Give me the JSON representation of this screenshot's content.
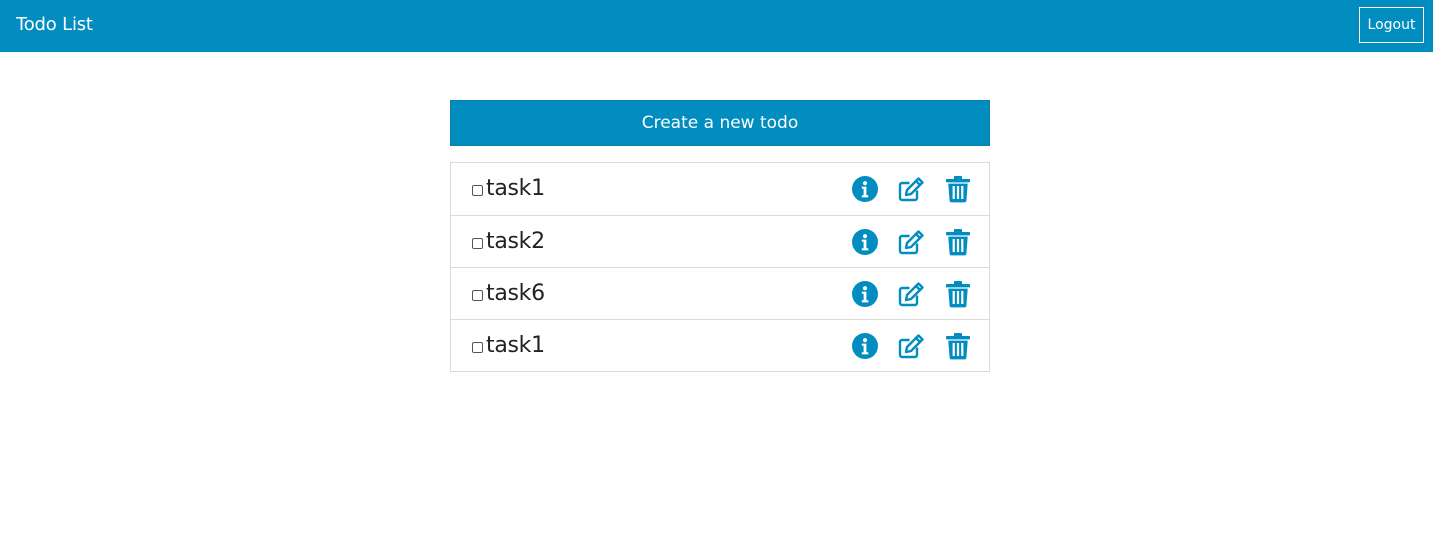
{
  "navbar": {
    "title": "Todo List",
    "logout_label": "Logout",
    "color": "#018dbf"
  },
  "main": {
    "create_label": "Create a new todo",
    "todos": [
      {
        "label": "task1",
        "checked": false
      },
      {
        "label": "task2",
        "checked": false
      },
      {
        "label": "task6",
        "checked": false
      },
      {
        "label": "task1",
        "checked": false
      }
    ],
    "row_icons": [
      "info-circle-icon",
      "edit-icon",
      "trash-icon"
    ],
    "icon_color": "#018dbf"
  }
}
